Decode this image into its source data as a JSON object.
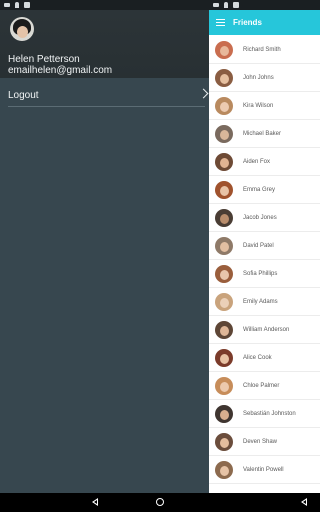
{
  "drawer": {
    "profile_name": "Helen Petterson",
    "profile_email": "emailhelen@gmail.com",
    "logout_label": "Logout",
    "background_color": "#37474f"
  },
  "appbar": {
    "title": "Friends",
    "accent_color": "#26c6da",
    "menu_icon": "hamburger-menu-icon"
  },
  "friends": [
    {
      "name": "Richard Smith",
      "skin": "#e8b89b",
      "bg": "#c96d4f"
    },
    {
      "name": "John Johns",
      "skin": "#e6c0a0",
      "bg": "#8a5d42"
    },
    {
      "name": "Kira Wilson",
      "skin": "#eccab0",
      "bg": "#b98a5f"
    },
    {
      "name": "Michael Baker",
      "skin": "#d9b79a",
      "bg": "#7a6a5e"
    },
    {
      "name": "Aiden Fox",
      "skin": "#e1b392",
      "bg": "#6e4a35"
    },
    {
      "name": "Emma Grey",
      "skin": "#e9c3a6",
      "bg": "#a0522d"
    },
    {
      "name": "Jacob Jones",
      "skin": "#b98d6c",
      "bg": "#4a3d34"
    },
    {
      "name": "David Patel",
      "skin": "#e2bfa2",
      "bg": "#8f7a68"
    },
    {
      "name": "Sofia Phillips",
      "skin": "#e9c6ab",
      "bg": "#9a5e3c"
    },
    {
      "name": "Emily Adams",
      "skin": "#ebd0b8",
      "bg": "#c9a37c"
    },
    {
      "name": "William Anderson",
      "skin": "#dfb697",
      "bg": "#5e4636"
    },
    {
      "name": "Alice Cook",
      "skin": "#e8c2a4",
      "bg": "#7b3b2a"
    },
    {
      "name": "Chloe Palmer",
      "skin": "#ecc9ad",
      "bg": "#c78d5a"
    },
    {
      "name": "Sebastián Johnston",
      "skin": "#d8ae8e",
      "bg": "#3f3530"
    },
    {
      "name": "Deven Shaw",
      "skin": "#e4bd9e",
      "bg": "#6b4d3c"
    },
    {
      "name": "Valentin Powell",
      "skin": "#e6c3a6",
      "bg": "#8c6a4e"
    }
  ],
  "navbar": {
    "back_icon": "back-triangle-icon",
    "home_icon": "home-circle-icon"
  }
}
